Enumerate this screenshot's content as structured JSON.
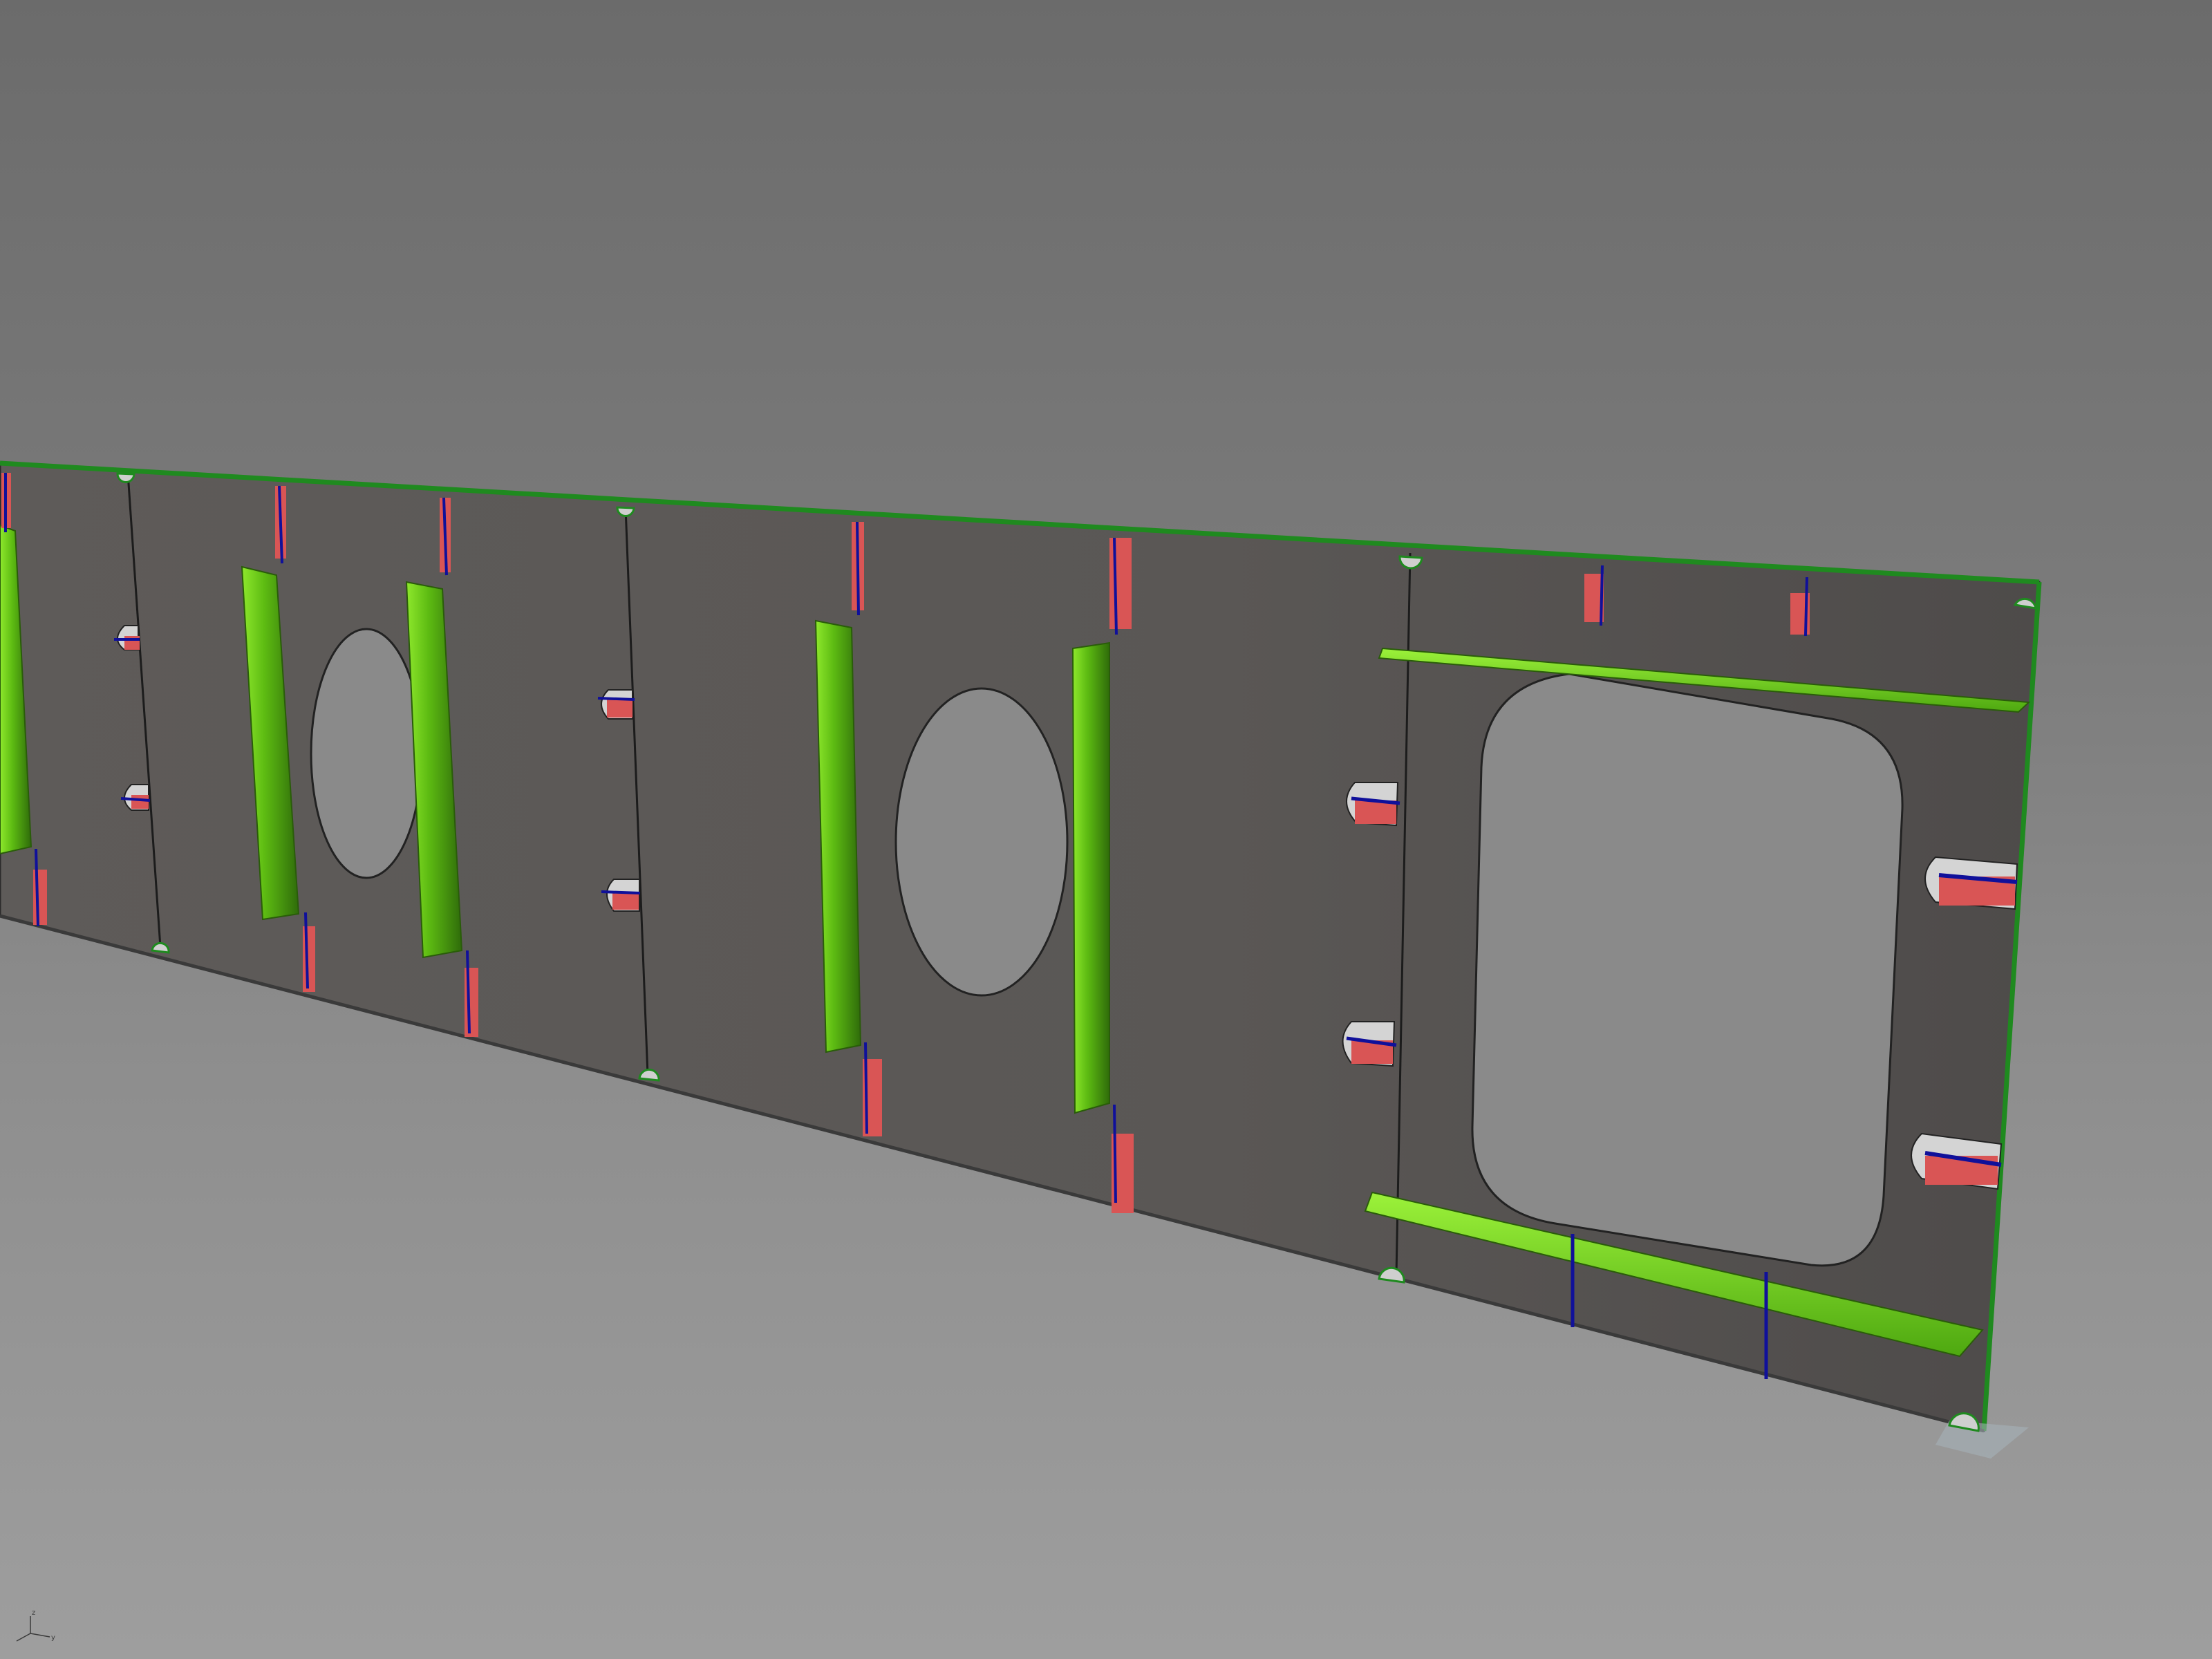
{
  "viewport": {
    "background_top": "#6b6b6b",
    "background_bottom": "#9e9e9e"
  },
  "model": {
    "plate_color": "#5c5957",
    "edge_color": "#1f8a1f",
    "stiffener_color": "#6fd81a",
    "stiffener_dark": "#3f8a10",
    "weld_color": "#d95555",
    "seam_color": "#1010a0",
    "opening_color": "#8a8a8a"
  },
  "axis_triad": {
    "icon": "axis-triad-icon",
    "z_label": "z",
    "y_label": "y"
  }
}
